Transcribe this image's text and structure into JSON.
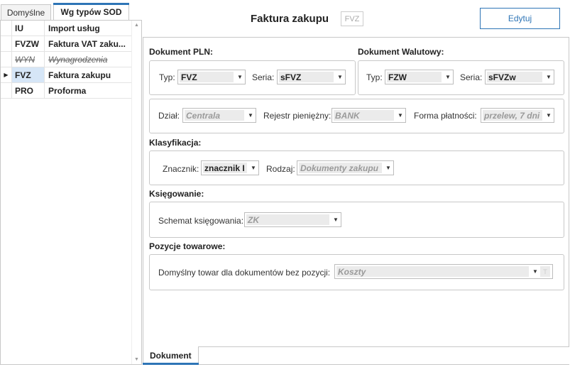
{
  "left_tabs": [
    {
      "label": "Domyślne"
    },
    {
      "label": "Wg typów SOD"
    }
  ],
  "rows": [
    {
      "code": "IU",
      "name": "Import usług",
      "indicator": ""
    },
    {
      "code": "FVZW",
      "name": "Faktura VAT zaku...",
      "indicator": ""
    },
    {
      "code": "WYN",
      "name": "Wynagrodzenia",
      "indicator": ""
    },
    {
      "code": "FVZ",
      "name": "Faktura zakupu",
      "indicator": "▶"
    },
    {
      "code": "PRO",
      "name": "Proforma",
      "indicator": ""
    }
  ],
  "header": {
    "title": "Faktura zakupu",
    "code": "FVZ",
    "edit_label": "Edytuj"
  },
  "pln": {
    "section": "Dokument PLN:",
    "typ_label": "Typ:",
    "typ_value": "FVZ",
    "seria_label": "Seria:",
    "seria_value": "sFVZ"
  },
  "walutowy": {
    "section": "Dokument Walutowy:",
    "typ_label": "Typ:",
    "typ_value": "FZW",
    "seria_label": "Seria:",
    "seria_value": "sFVZw"
  },
  "misc": {
    "dzial_label": "Dział:",
    "dzial_value": "Centrala",
    "rejestr_label": "Rejestr pieniężny:",
    "rejestr_value": "BANK",
    "forma_label": "Forma płatności:",
    "forma_value": "przelew, 7 dni"
  },
  "klasyfikacja": {
    "section": "Klasyfikacja:",
    "znacznik_label": "Znacznik:",
    "znacznik_value": "znacznik I",
    "rodzaj_label": "Rodzaj:",
    "rodzaj_value": "Dokumenty zakupu"
  },
  "ksiegowanie": {
    "section": "Księgowanie:",
    "schemat_label": "Schemat księgowania:",
    "schemat_value": "ZK"
  },
  "towarowe": {
    "section": "Pozycje towarowe:",
    "towar_label": "Domyślny towar dla dokumentów bez pozycji:",
    "towar_value": "Koszty",
    "t_button": "T"
  },
  "bottom_tab": {
    "label": "Dokument"
  },
  "colors": {
    "accent": "#2e75b6",
    "selected_row": "#d6e6f7"
  }
}
